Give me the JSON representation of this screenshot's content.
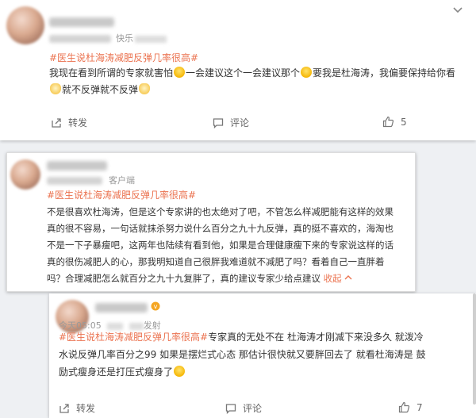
{
  "comments": [
    {
      "source": "快乐",
      "hashtag": "#医生说杜海涛减肥反弹几率很高#",
      "segments": [
        "我现在看到所谓的专家就害怕",
        "一会建议这个一会建议那个",
        "要我是杜海涛，我偏要保持给你看",
        "就不反弹就不反弹"
      ],
      "forward_label": "转发",
      "comment_label": "评论",
      "like_count": "5"
    },
    {
      "source": "客户端",
      "hashtag": "#医生说杜海涛减肥反弹几率很高#",
      "text_lines": [
        "不是很喜欢杜海涛，但是这个专家讲的也太绝对了吧，不管怎么样减肥能有这样的效果",
        "真的很不容易，一句话就抹杀努力说什么百分之九十九反弹，真的挺不喜欢的，海淘也",
        "不是一下子暴瘦吧，这两年也陆续有看到他，如果是合理健康瘦下来的专家说这样的话",
        "真的很伤减肥人的心，那我明知道自己很胖我难道就不减肥了吗？看着自己一直胖着",
        "吗？合理减肥怎么就百分之九十九复胖了，真的建议专家少给点建议"
      ],
      "collapse_label": "收起",
      "collapse_icon": "chevron-up-icon"
    },
    {
      "time": "今天05:05",
      "source": "发射",
      "hashtag": "#医生说杜海涛减肥反弹几率很高#",
      "text_rest_line1": "专家真的无处不在 杜海涛才刚减下来没多久 就泼冷",
      "text_line2": "水说反弹几率百分之99 如果是摆烂式心态 那估计很快就又要胖回去了 就看杜海涛是 鼓",
      "text_line3": "励式瘦身还是打压式瘦身了",
      "forward_label": "转发",
      "comment_label": "评论",
      "like_count": "7"
    }
  ],
  "icons": [
    "chevron-down-icon",
    "forward-icon",
    "comment-icon",
    "like-icon",
    "emoji-laugh-icon",
    "emoji-cat-icon"
  ],
  "colors": {
    "hashtag": "#eb7350",
    "text": "#333333",
    "meta": "#999999"
  }
}
